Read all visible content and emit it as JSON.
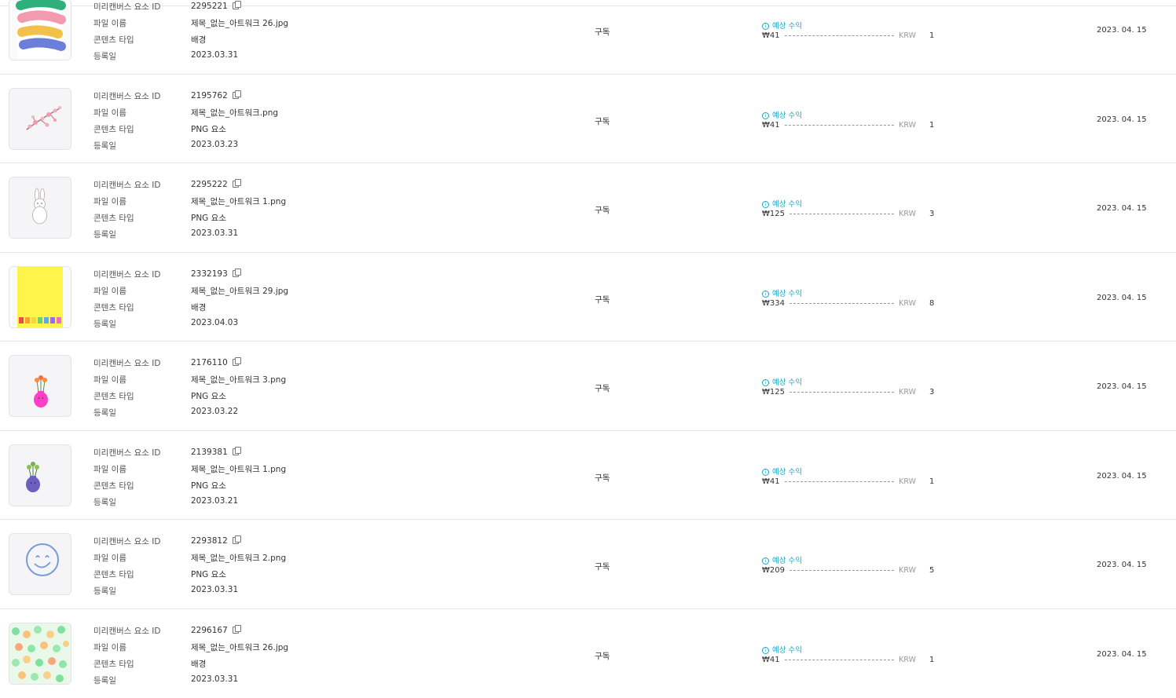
{
  "labels": {
    "element_id": "미리캔버스 요소 ID",
    "file_name": "파일 이름",
    "content_type": "콘텐츠 타입",
    "registered": "등록일",
    "estimated_revenue": "예상 수익",
    "currency": "KRW"
  },
  "rows": [
    {
      "thumb": "brush-strokes-thumbnail",
      "id": "2295221",
      "file": "제목_없는_아트워크 26.jpg",
      "type": "배경",
      "registered": "2023.03.31",
      "plan": "구독",
      "amount": "₩41",
      "count": "1",
      "date": "2023. 04. 15"
    },
    {
      "thumb": "cherry-blossom-thumbnail",
      "id": "2195762",
      "file": "제목_없는_아트워크.png",
      "type": "PNG 요소",
      "registered": "2023.03.23",
      "plan": "구독",
      "amount": "₩41",
      "count": "1",
      "date": "2023. 04. 15"
    },
    {
      "thumb": "rabbit-thumbnail",
      "id": "2295222",
      "file": "제목_없는_아트워크 1.png",
      "type": "PNG 요소",
      "registered": "2023.03.31",
      "plan": "구독",
      "amount": "₩125",
      "count": "3",
      "date": "2023. 04. 15"
    },
    {
      "thumb": "yellow-background-thumbnail",
      "id": "2332193",
      "file": "제목_없는_아트워크 29.jpg",
      "type": "배경",
      "registered": "2023.04.03",
      "plan": "구독",
      "amount": "₩334",
      "count": "8",
      "date": "2023. 04. 15"
    },
    {
      "thumb": "pink-vase-thumbnail",
      "id": "2176110",
      "file": "제목_없는_아트워크 3.png",
      "type": "PNG 요소",
      "registered": "2023.03.22",
      "plan": "구독",
      "amount": "₩125",
      "count": "3",
      "date": "2023. 04. 15"
    },
    {
      "thumb": "purple-vase-thumbnail",
      "id": "2139381",
      "file": "제목_없는_아트워크 1.png",
      "type": "PNG 요소",
      "registered": "2023.03.21",
      "plan": "구독",
      "amount": "₩41",
      "count": "1",
      "date": "2023. 04. 15"
    },
    {
      "thumb": "smiley-face-thumbnail",
      "id": "2293812",
      "file": "제목_없는_아트워크 2.png",
      "type": "PNG 요소",
      "registered": "2023.03.31",
      "plan": "구독",
      "amount": "₩209",
      "count": "5",
      "date": "2023. 04. 15"
    },
    {
      "thumb": "polka-dot-thumbnail",
      "id": "2296167",
      "file": "제목_없는_아트워크 26.jpg",
      "type": "배경",
      "registered": "2023.03.31",
      "plan": "구독",
      "amount": "₩41",
      "count": "1",
      "date": "2023. 04. 15"
    }
  ]
}
